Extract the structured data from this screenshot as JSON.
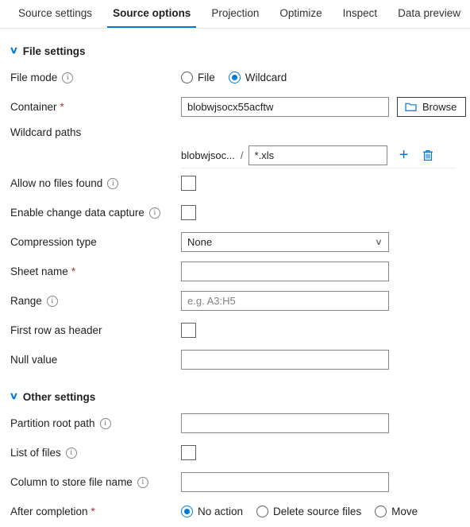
{
  "tabs": [
    {
      "label": "Source settings",
      "active": false
    },
    {
      "label": "Source options",
      "active": true
    },
    {
      "label": "Projection",
      "active": false
    },
    {
      "label": "Optimize",
      "active": false
    },
    {
      "label": "Inspect",
      "active": false
    },
    {
      "label": "Data preview",
      "active": false
    }
  ],
  "colors": {
    "accent": "#0078d4",
    "required_asterisk": "#a4373a",
    "border": "#8a8886",
    "text": "#201f1e"
  },
  "sections": {
    "file_settings": {
      "title": "File settings",
      "chevron": "chevron-down-icon"
    },
    "other_settings": {
      "title": "Other settings",
      "chevron": "chevron-down-icon"
    }
  },
  "file_mode": {
    "label": "File mode",
    "info": "info-icon",
    "options": [
      {
        "label": "File",
        "selected": false
      },
      {
        "label": "Wildcard",
        "selected": true
      }
    ]
  },
  "container": {
    "label": "Container",
    "required": "*",
    "value": "blobwjsocx55acftw",
    "placeholder": "",
    "browse_label": "Browse",
    "browse_icon": "folder-icon"
  },
  "wildcard_paths": {
    "label": "Wildcard paths",
    "prefix": "blobwjsoc...",
    "separator": "/",
    "value": "*.xls",
    "placeholder": "",
    "add_icon": "plus-icon",
    "delete_icon": "trash-icon"
  },
  "allow_no_files_found": {
    "label": "Allow no files found",
    "info": "info-icon",
    "checked": false
  },
  "enable_change_data_capture": {
    "label": "Enable change data capture",
    "info": "info-icon",
    "checked": false
  },
  "compression_type": {
    "label": "Compression type",
    "value": "None",
    "chevron": "chevron-down-icon"
  },
  "sheet_name": {
    "label": "Sheet name",
    "required": "*",
    "value": "",
    "placeholder": ""
  },
  "range": {
    "label": "Range",
    "info": "info-icon",
    "value": "",
    "placeholder": "e.g. A3:H5"
  },
  "first_row_as_header": {
    "label": "First row as header",
    "checked": false
  },
  "null_value": {
    "label": "Null value",
    "value": "",
    "placeholder": ""
  },
  "partition_root_path": {
    "label": "Partition root path",
    "info": "info-icon",
    "value": "",
    "placeholder": ""
  },
  "list_of_files": {
    "label": "List of files",
    "info": "info-icon",
    "checked": false
  },
  "column_to_store_file_name": {
    "label": "Column to store file name",
    "info": "info-icon",
    "value": "",
    "placeholder": ""
  },
  "after_completion": {
    "label": "After completion",
    "required": "*",
    "options": [
      {
        "label": "No action",
        "selected": true
      },
      {
        "label": "Delete source files",
        "selected": false
      },
      {
        "label": "Move",
        "selected": false
      }
    ]
  }
}
